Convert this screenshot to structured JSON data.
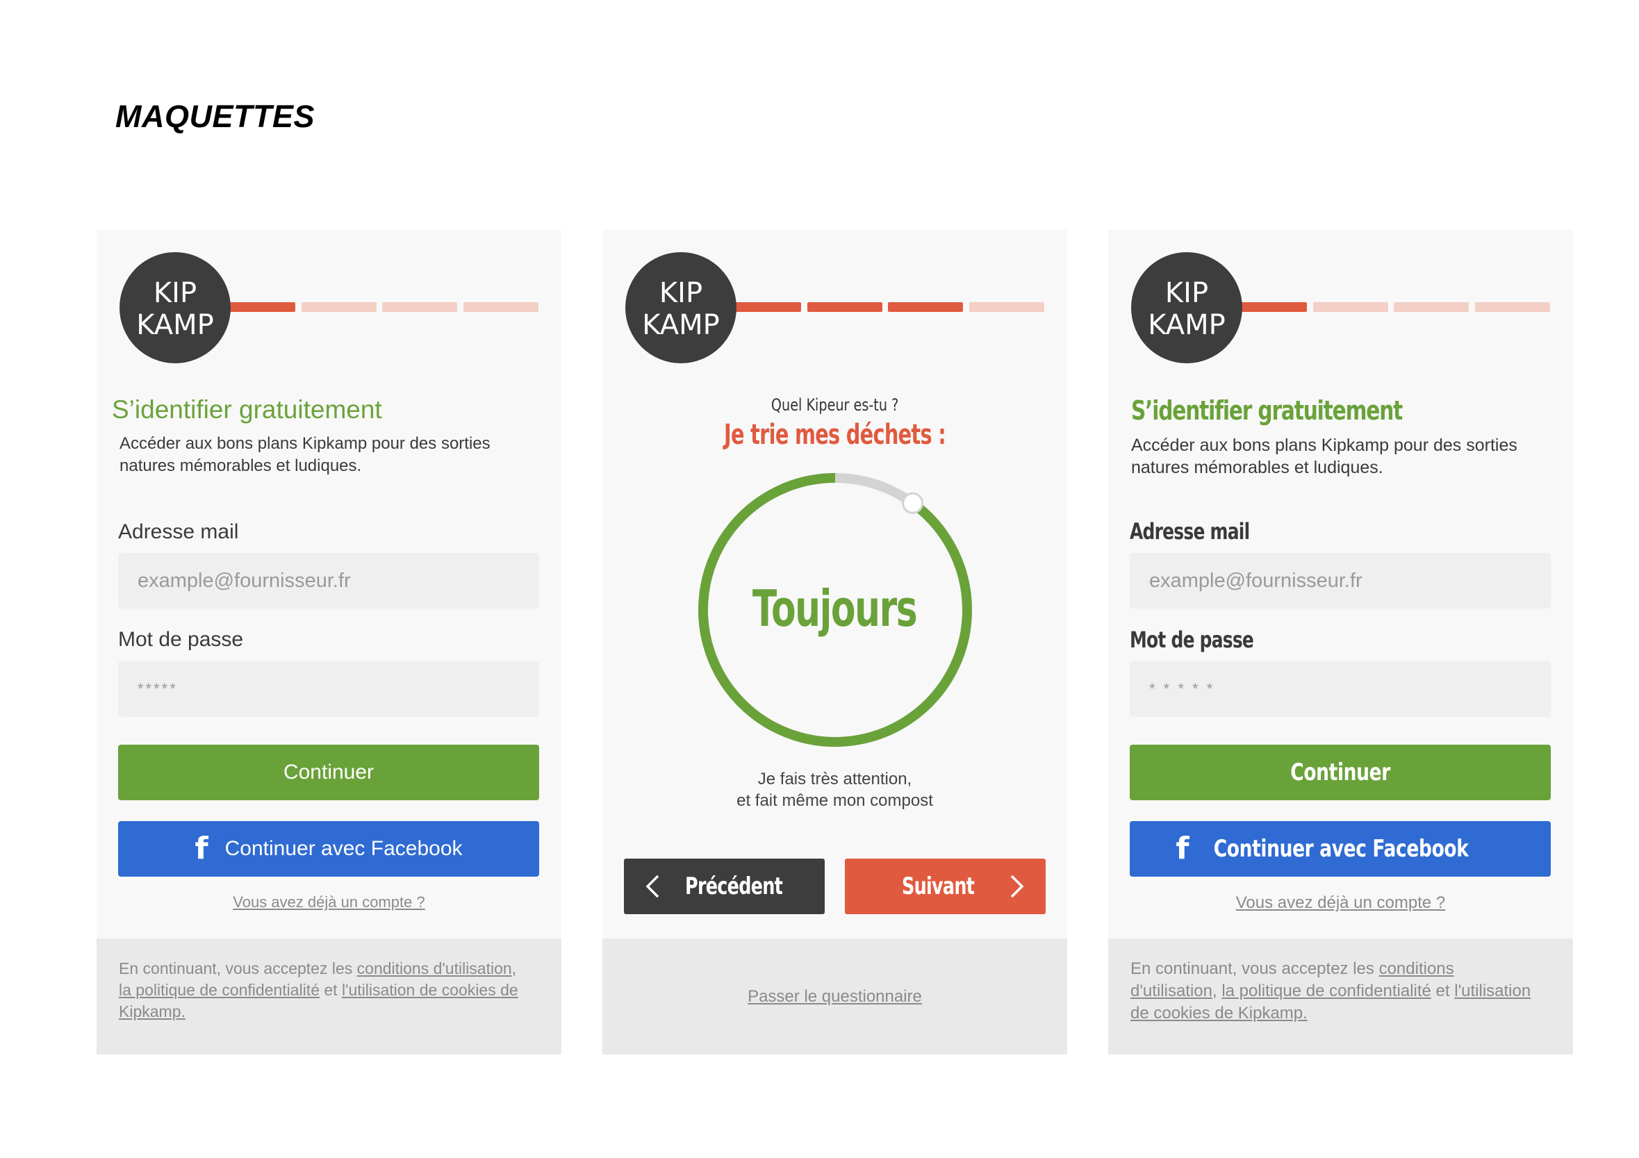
{
  "page_title": "MAQUETTES",
  "colors": {
    "accent_red": "#e05a3f",
    "accent_green": "#6aa23a",
    "facebook_blue": "#2f6bd2",
    "dark": "#3d3d3d"
  },
  "logo": {
    "line1": "KIP",
    "line2": "KAMP"
  },
  "screen1": {
    "progress": {
      "step": 1,
      "total": 4
    },
    "heading": "S’identifier gratuitement",
    "subtext": "Accéder aux bons plans Kipkamp pour des sorties natures mémorables et ludiques.",
    "email_label": "Adresse mail",
    "email_placeholder": "example@fournisseur.fr",
    "password_label": "Mot de passe",
    "password_placeholder": "*****",
    "continue_button": "Continuer",
    "facebook_button": "Continuer avec Facebook",
    "facebook_icon": "facebook-icon",
    "existing_account_link": "Vous avez déjà un compte ?",
    "footer": {
      "prefix": "En continuant, vous acceptez les ",
      "terms_link": "conditions d'utilisation",
      "sep": ", ",
      "privacy_link": "la politique de confidentialité",
      "and": " et ",
      "cookies_link": "l'utilisation de cookies de Kipkamp."
    }
  },
  "screen2": {
    "progress": {
      "step": 3,
      "total": 4
    },
    "question": "Quel Kipeur es-tu ?",
    "topic": "Je trie mes déchets :",
    "dial_value_label": "Toujours",
    "dial_level": 0.9,
    "answer_description_line1": "Je fais très attention,",
    "answer_description_line2": "et fait même mon compost",
    "prev_button": "Précédent",
    "next_button": "Suivant",
    "skip_link": "Passer le questionnaire"
  },
  "screen3": {
    "progress": {
      "step": 1,
      "total": 4
    },
    "heading": "S’identifier gratuitement",
    "subtext": "Accéder aux bons plans Kipkamp pour des sorties natures mémorables et ludiques.",
    "email_label": "Adresse mail",
    "email_placeholder": "example@fournisseur.fr",
    "password_label": "Mot de passe",
    "password_placeholder": "* * * * *",
    "continue_button": "Continuer",
    "facebook_button": "Continuer avec Facebook",
    "facebook_icon": "facebook-icon",
    "existing_account_link": "Vous avez déjà un compte ?",
    "footer": {
      "prefix": "En continuant, vous acceptez les ",
      "terms_link": "conditions d'utilisation",
      "sep": ", ",
      "privacy_link": "la politique de confidentialité",
      "and": " et ",
      "cookies_link": "l'utilisation de cookies de Kipkamp."
    }
  }
}
